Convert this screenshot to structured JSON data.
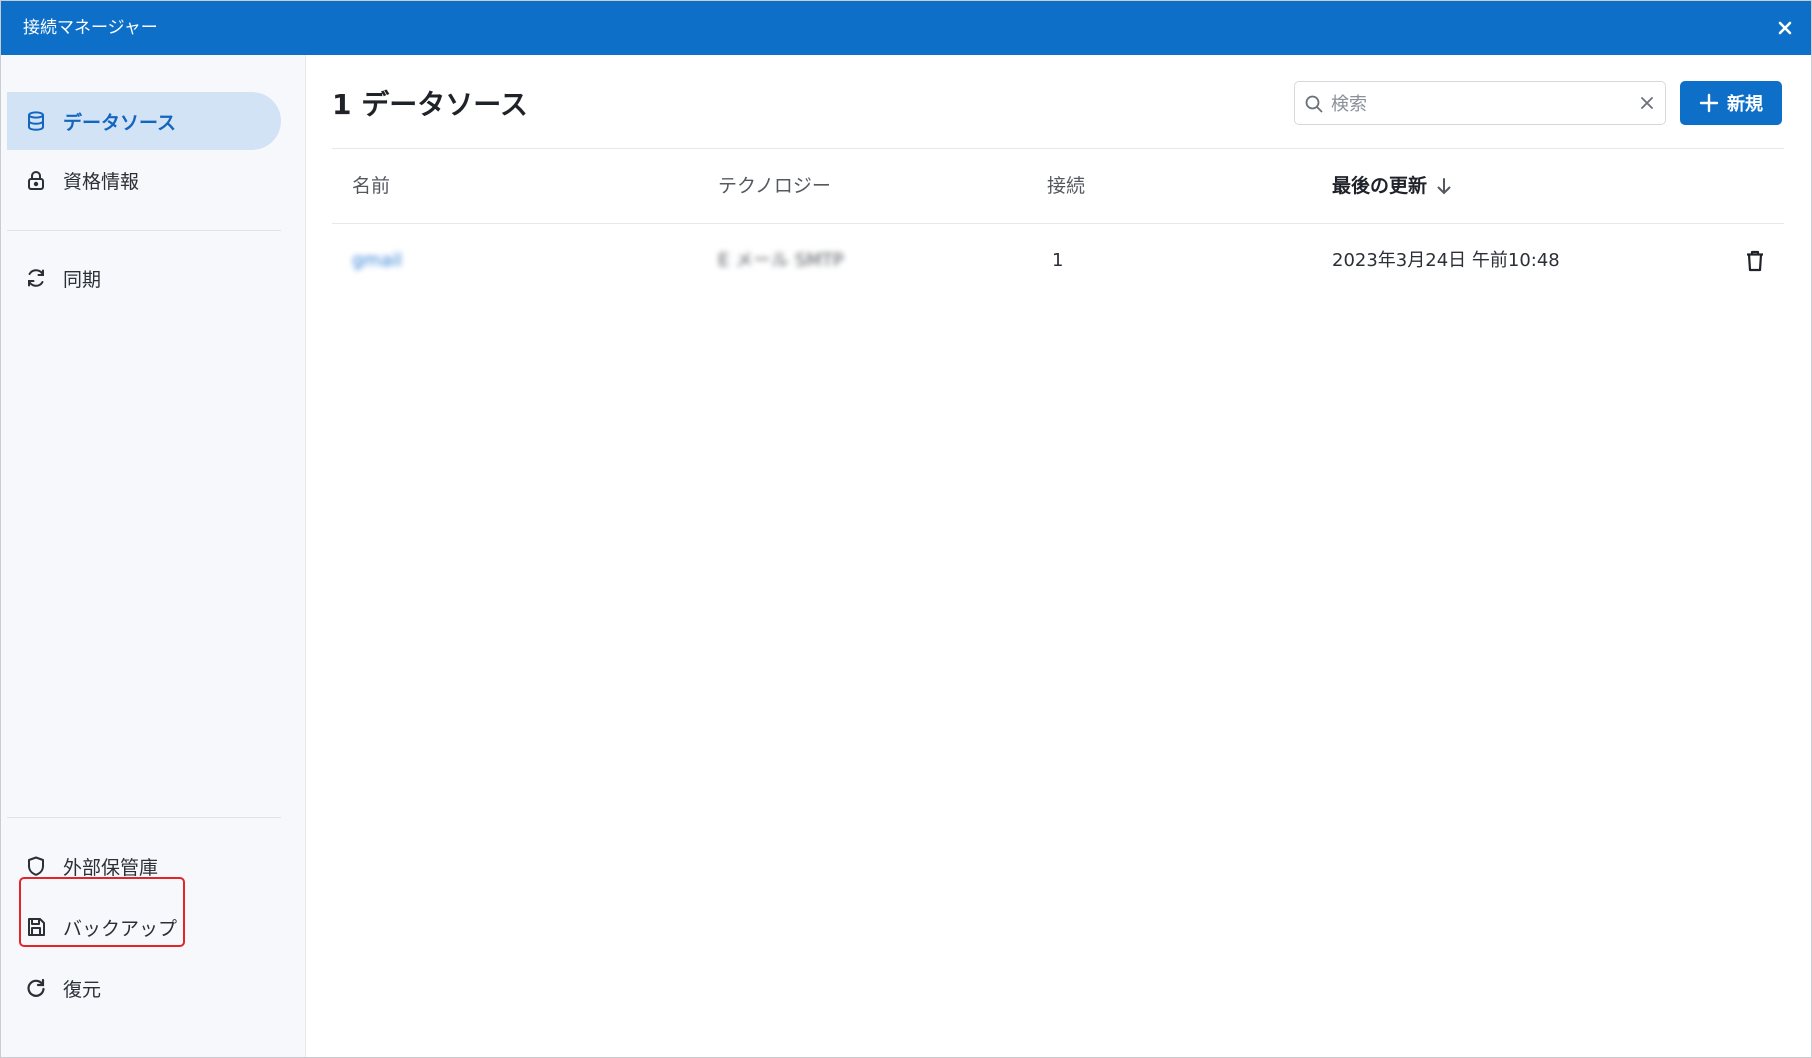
{
  "window": {
    "title": "接続マネージャー"
  },
  "sidebar": {
    "items": [
      {
        "label": "データソース",
        "icon": "database-icon",
        "active": true
      },
      {
        "label": "資格情報",
        "icon": "lock-icon",
        "active": false
      },
      {
        "label": "同期",
        "icon": "sync-icon",
        "active": false
      },
      {
        "label": "外部保管庫",
        "icon": "shield-icon",
        "active": false,
        "highlighted": true
      },
      {
        "label": "バックアップ",
        "icon": "save-icon",
        "active": false
      },
      {
        "label": "復元",
        "icon": "restore-icon",
        "active": false
      }
    ]
  },
  "main": {
    "title": "1 データソース",
    "search": {
      "placeholder": "検索",
      "value": ""
    },
    "new_button_label": "新規",
    "table": {
      "columns": [
        "名前",
        "テクノロジー",
        "接続",
        "最後の更新"
      ],
      "sorted_column": "最後の更新",
      "sort_direction": "descending",
      "rows": [
        {
          "name": "gmail",
          "technology": "E メール SMTP",
          "connections": "1",
          "last_updated": "2023年3月24日 午前10:48"
        }
      ]
    }
  },
  "colors": {
    "accent": "#0e6fc8",
    "active_nav_bg": "#d3e3f6",
    "highlight_border": "#e3242b"
  }
}
